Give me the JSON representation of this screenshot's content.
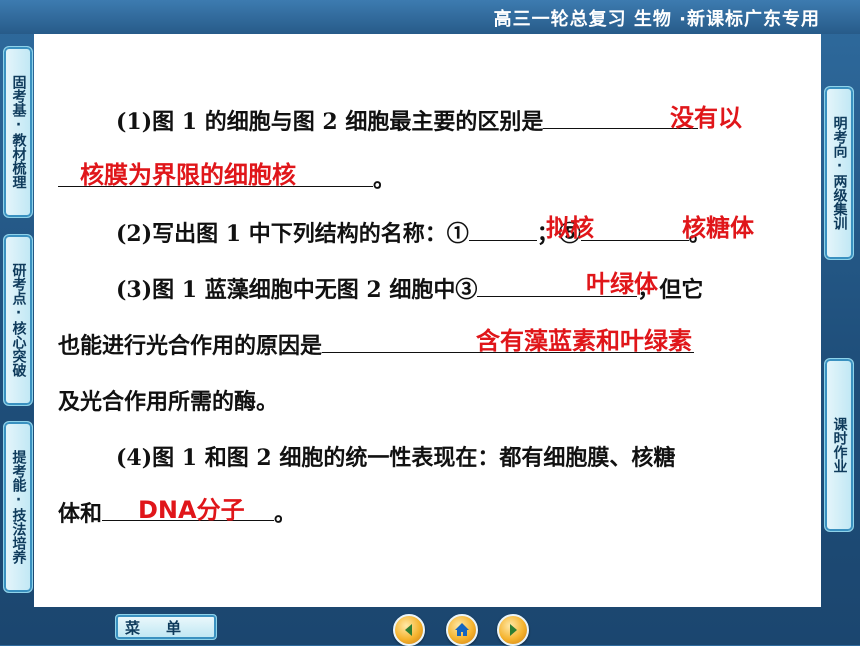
{
  "header": {
    "title": "高三一轮总复习 生物 ·新课标广东专用"
  },
  "left_tabs": [
    "固考基·教材梳理",
    "研考点·核心突破",
    "提考能·技法培养"
  ],
  "right_tabs": [
    "明考向·两级集训",
    "课时作业"
  ],
  "questions": {
    "q1_line1": "(1)图 1 的细胞与图 2 细胞最主要的区别是",
    "q1_ans_a": "没有以",
    "q1_ans_b": "核膜为界限的细胞核",
    "q1_end": "。",
    "q2_text": "(2)写出图 1 中下列结构的名称：①",
    "q2_ans1": "拟核",
    "q2_mid": "；⑤",
    "q2_ans2": "核糖体",
    "q2_end": "。",
    "q3_line1": "(3)图 1 蓝藻细胞中无图 2 细胞中③",
    "q3_ans1": "叶绿体",
    "q3_line1_end": "，但它",
    "q3_line2": "也能进行光合作用的原因是",
    "q3_ans2": "含有藻蓝素和叶绿素",
    "q3_line3": "及光合作用所需的酶。",
    "q4_line1": "(4)图 1 和图 2 细胞的统一性表现在：都有细胞膜、核糖",
    "q4_line2": "体和",
    "q4_ans": "DNA分子",
    "q4_end": "。"
  },
  "footer": {
    "menu_label": "菜单"
  }
}
